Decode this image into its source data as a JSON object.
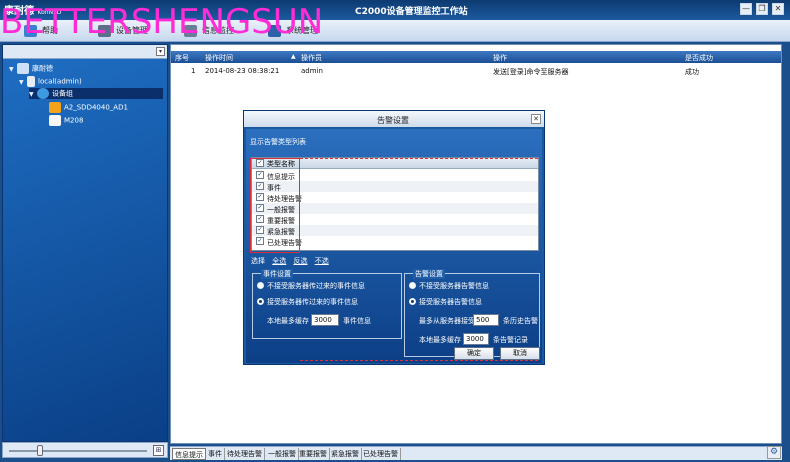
{
  "window": {
    "logo": "康耐德",
    "logo_sub": "KonNaD",
    "title": "C2000设备管理监控工作站",
    "minimize_glyph": "—",
    "restore_glyph": "❐",
    "close_glyph": "✕",
    "watermark": "BETTERSHENGSUN"
  },
  "toolbar": {
    "items": [
      {
        "label": "帮助",
        "icon": "help-icon"
      },
      {
        "label": "设备管理",
        "icon": "gear-icon"
      },
      {
        "label": "信息监控",
        "icon": "monitor-icon"
      },
      {
        "label": "系统管理",
        "icon": "system-icon"
      }
    ]
  },
  "tree": {
    "root": "康耐德",
    "server": "local(admin)",
    "group": "设备组",
    "devices": [
      "A2_SDD4040_AD1",
      "M208"
    ]
  },
  "grid": {
    "columns": [
      "序号",
      "操作时间",
      "操作员",
      "操作",
      "是否成功"
    ],
    "sort_glyph": "▲",
    "rows": [
      {
        "no": "1",
        "time": "2014-08-23 08:38:21",
        "operator": "admin",
        "action": "发送[登录]命令至服务器",
        "success": "成功"
      }
    ]
  },
  "dialog": {
    "title": "告警设置",
    "close_glyph": "✕",
    "list_title": "显示告警类型列表",
    "list_header": "类型名称",
    "types": [
      "信息提示",
      "事件",
      "待处理告警",
      "一般报警",
      "重要报警",
      "紧急报警",
      "已处理告警"
    ],
    "select_label": "选择",
    "select_all": "全选",
    "select_invert": "反选",
    "select_none": "不选",
    "event_group": {
      "title": "事件设置",
      "opt_no": "不接受服务器传过来的事件信息",
      "opt_yes": "接受服务器传过来的事件信息",
      "cache_prefix": "本地最多缓存",
      "cache_value": "3000",
      "cache_suffix": "事件信息"
    },
    "alarm_group": {
      "title": "告警设置",
      "opt_no": "不接受服务器告警信息",
      "opt_yes": "接受服务器告警信息",
      "fetch_prefix": "最多从服务器接受",
      "fetch_value": "500",
      "fetch_suffix": "条历史告警",
      "cache_prefix": "本地最多缓存",
      "cache_value": "3000",
      "cache_suffix": "条告警记录"
    },
    "ok": "确定",
    "cancel": "取消"
  },
  "bottom_tabs": [
    "信息提示",
    "事件",
    "待处理告警",
    "一般报警",
    "重要报警",
    "紧急报警",
    "已处理告警"
  ],
  "sidebar_bottom": {
    "slider_fraction": 0.2
  }
}
